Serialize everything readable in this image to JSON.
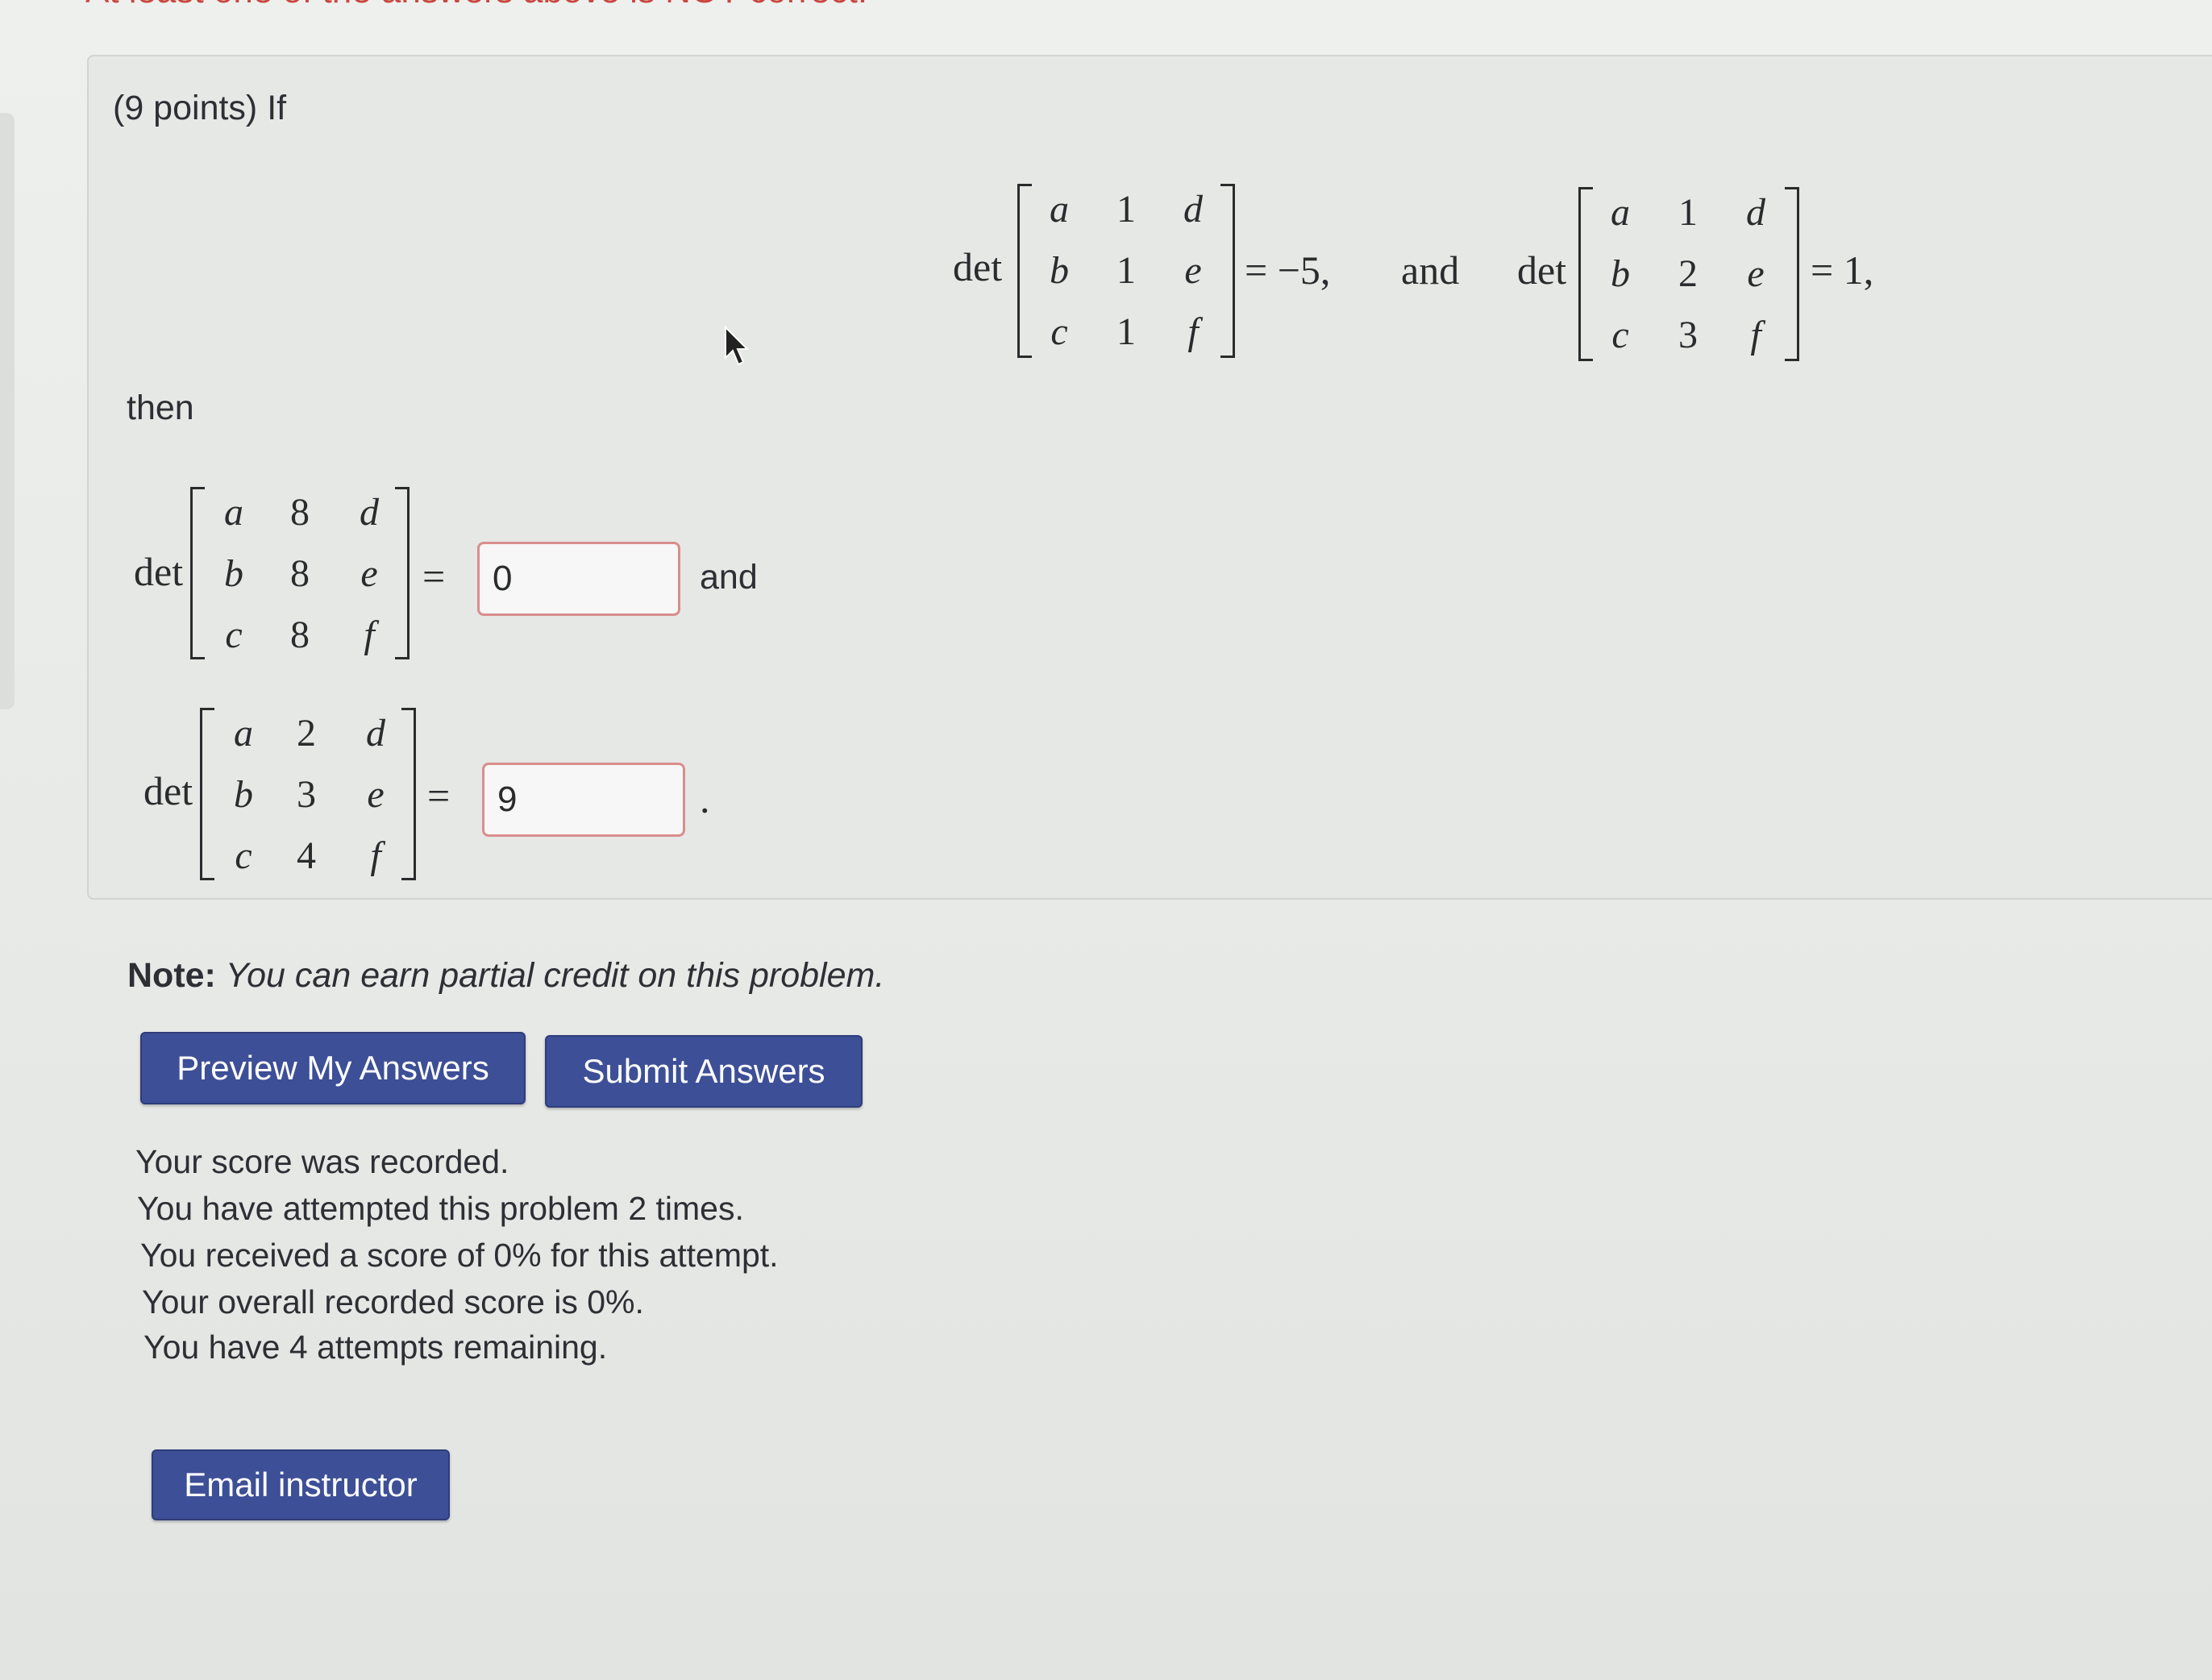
{
  "feedback": {
    "message": "At least one of the answers above is NOT correct."
  },
  "problem": {
    "intro": "(9 points) If",
    "given": {
      "m1": {
        "det_label": "det",
        "rows": [
          [
            "a",
            "1",
            "d"
          ],
          [
            "b",
            "1",
            "e"
          ],
          [
            "c",
            "1",
            "f"
          ]
        ],
        "result": "= −5,"
      },
      "conj": "and",
      "m2": {
        "det_label": "det",
        "rows": [
          [
            "a",
            "1",
            "d"
          ],
          [
            "b",
            "2",
            "e"
          ],
          [
            "c",
            "3",
            "f"
          ]
        ],
        "result": "= 1,"
      }
    },
    "then_label": "then",
    "q1": {
      "det_label": "det",
      "rows": [
        [
          "a",
          "8",
          "d"
        ],
        [
          "b",
          "8",
          "e"
        ],
        [
          "c",
          "8",
          "f"
        ]
      ],
      "equals": "=",
      "answer_value": "0",
      "after": "and"
    },
    "q2": {
      "det_label": "det",
      "rows": [
        [
          "a",
          "2",
          "d"
        ],
        [
          "b",
          "3",
          "e"
        ],
        [
          "c",
          "4",
          "f"
        ]
      ],
      "equals": "=",
      "answer_value": "9",
      "after": "."
    }
  },
  "note": {
    "label": "Note:",
    "text": "You can earn partial credit on this problem."
  },
  "buttons": {
    "preview": "Preview My Answers",
    "submit": "Submit Answers",
    "email": "Email instructor"
  },
  "status": {
    "line1": "Your score was recorded.",
    "line2": "You have attempted this problem 2 times.",
    "line3": "You received a score of 0% for this attempt.",
    "line4": "Your overall recorded score is 0%.",
    "line5": "You have 4 attempts remaining."
  },
  "colors": {
    "button_bg": "#3d4f96",
    "error_text": "#c9473f",
    "input_border": "#d98e8c"
  }
}
